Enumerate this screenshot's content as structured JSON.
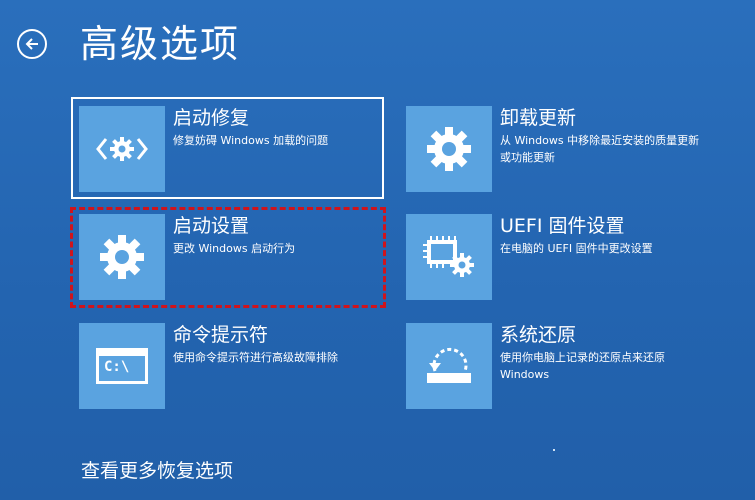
{
  "page": {
    "title": "高级选项",
    "more_link": "查看更多恢复选项"
  },
  "options": [
    {
      "id": "startup-repair",
      "label": "启动修复",
      "desc": "修复妨碍 Windows 加载的问题",
      "icon": "startup-repair-icon",
      "selected": true
    },
    {
      "id": "uninstall-updates",
      "label": "卸载更新",
      "desc": "从 Windows 中移除最近安装的质量更新或功能更新",
      "icon": "gear-icon"
    },
    {
      "id": "startup-settings",
      "label": "启动设置",
      "desc": "更改 Windows 启动行为",
      "icon": "gear-icon",
      "highlighted": true
    },
    {
      "id": "uefi-firmware",
      "label": "UEFI 固件设置",
      "desc": "在电脑的 UEFI 固件中更改设置",
      "icon": "firmware-chip-gear-icon"
    },
    {
      "id": "command-prompt",
      "label": "命令提示符",
      "desc": "使用命令提示符进行高级故障排除",
      "icon": "command-prompt-icon",
      "icon_text": "C:\\"
    },
    {
      "id": "system-restore",
      "label": "系统还原",
      "desc": "使用你电脑上记录的还原点来还原 Windows",
      "icon": "system-restore-icon"
    }
  ],
  "colors": {
    "background": "#2467b3",
    "tile": "#5aa3e0",
    "highlight": "#d0141c",
    "text": "#ffffff"
  }
}
